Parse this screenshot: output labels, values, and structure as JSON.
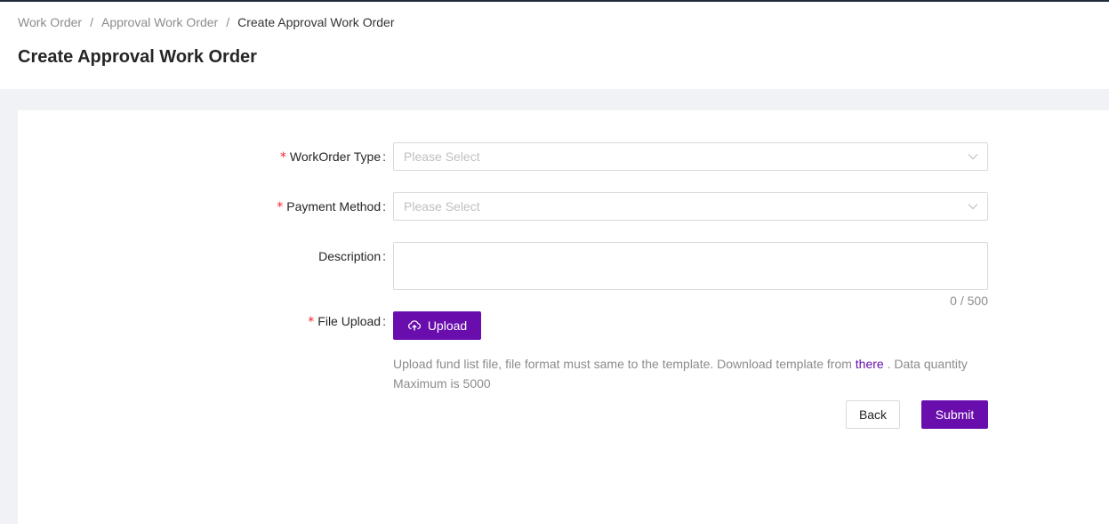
{
  "breadcrumb": {
    "items": [
      "Work Order",
      "Approval Work Order",
      "Create Approval Work Order"
    ],
    "separator": "/"
  },
  "page_title": "Create Approval Work Order",
  "form": {
    "workorder_type": {
      "label": "WorkOrder Type",
      "placeholder": "Please Select",
      "required": true
    },
    "payment_method": {
      "label": "Payment Method",
      "placeholder": "Please Select",
      "required": true
    },
    "description": {
      "label": "Description",
      "value": "",
      "counter": "0 / 500",
      "required": false
    },
    "file_upload": {
      "label": "File Upload",
      "required": true,
      "button_label": "Upload",
      "hint_before": "Upload fund list file, file format must same to the template. Download template from ",
      "hint_link": "there",
      "hint_after": " . Data quantity Maximum is 5000"
    },
    "required_mark": "*",
    "colon": ":"
  },
  "actions": {
    "back_label": "Back",
    "submit_label": "Submit"
  },
  "icons": {
    "select_chevron": "chevron-down-icon",
    "upload": "cloud-upload-icon"
  },
  "colors": {
    "primary": "#6a0dad",
    "required": "#f5222d",
    "background": "#f0f2f5"
  }
}
